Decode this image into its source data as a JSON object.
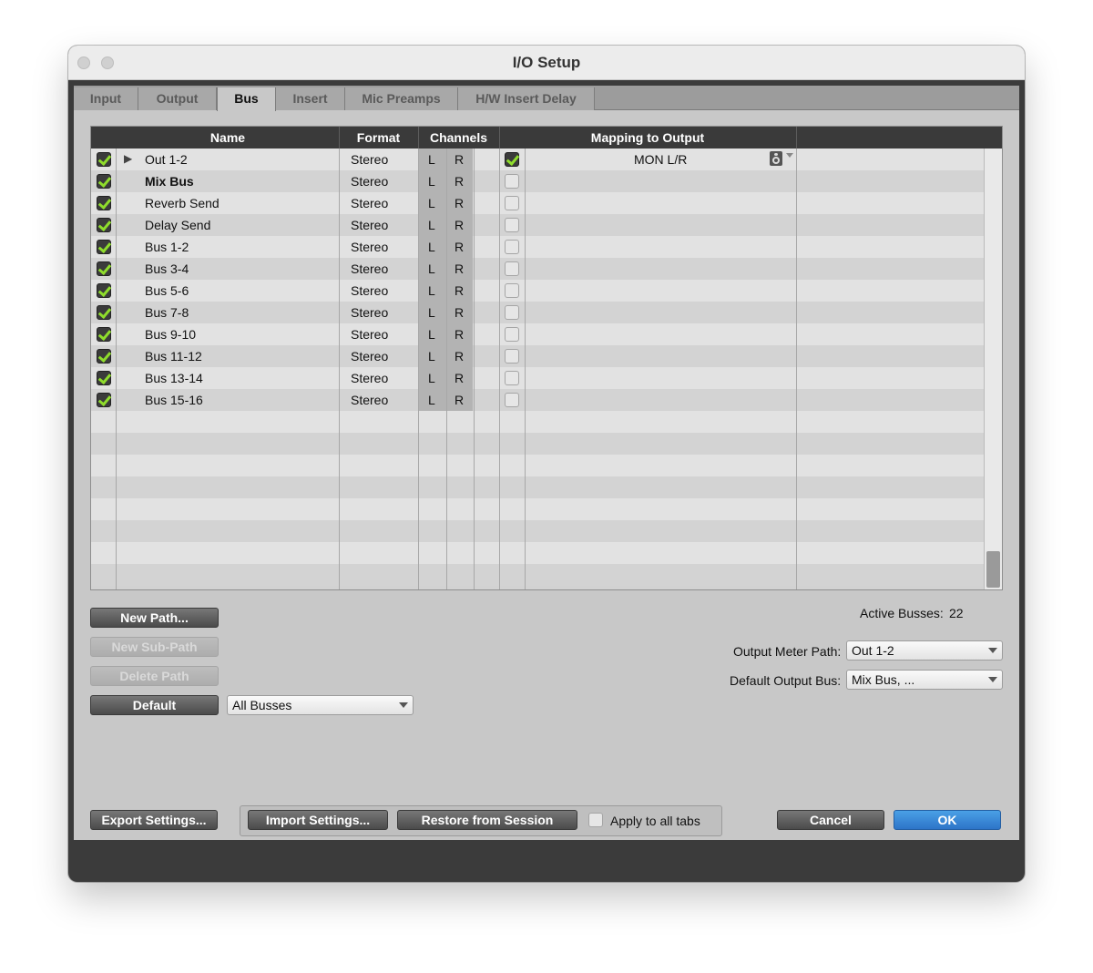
{
  "window": {
    "title": "I/O Setup"
  },
  "tabs": [
    {
      "label": "Input",
      "active": false
    },
    {
      "label": "Output",
      "active": false
    },
    {
      "label": "Bus",
      "active": true
    },
    {
      "label": "Insert",
      "active": false
    },
    {
      "label": "Mic Preamps",
      "active": false
    },
    {
      "label": "H/W Insert Delay",
      "active": false
    }
  ],
  "table": {
    "headers": {
      "name": "Name",
      "format": "Format",
      "channels": "Channels",
      "mapping": "Mapping to Output"
    },
    "rows": [
      {
        "active": true,
        "expander": "▶",
        "name": "Out 1-2",
        "bold": false,
        "format": "Stereo",
        "left": "L",
        "right": "R",
        "mapped": true,
        "mapping": "MON L/R"
      },
      {
        "active": true,
        "expander": "",
        "name": "Mix Bus",
        "bold": true,
        "format": "Stereo",
        "left": "L",
        "right": "R",
        "mapped": false,
        "mapping": ""
      },
      {
        "active": true,
        "expander": "",
        "name": "Reverb Send",
        "bold": false,
        "format": "Stereo",
        "left": "L",
        "right": "R",
        "mapped": false,
        "mapping": ""
      },
      {
        "active": true,
        "expander": "",
        "name": "Delay Send",
        "bold": false,
        "format": "Stereo",
        "left": "L",
        "right": "R",
        "mapped": false,
        "mapping": ""
      },
      {
        "active": true,
        "expander": "",
        "name": "Bus 1-2",
        "bold": false,
        "format": "Stereo",
        "left": "L",
        "right": "R",
        "mapped": false,
        "mapping": ""
      },
      {
        "active": true,
        "expander": "",
        "name": "Bus 3-4",
        "bold": false,
        "format": "Stereo",
        "left": "L",
        "right": "R",
        "mapped": false,
        "mapping": ""
      },
      {
        "active": true,
        "expander": "",
        "name": "Bus 5-6",
        "bold": false,
        "format": "Stereo",
        "left": "L",
        "right": "R",
        "mapped": false,
        "mapping": ""
      },
      {
        "active": true,
        "expander": "",
        "name": "Bus 7-8",
        "bold": false,
        "format": "Stereo",
        "left": "L",
        "right": "R",
        "mapped": false,
        "mapping": ""
      },
      {
        "active": true,
        "expander": "",
        "name": "Bus 9-10",
        "bold": false,
        "format": "Stereo",
        "left": "L",
        "right": "R",
        "mapped": false,
        "mapping": ""
      },
      {
        "active": true,
        "expander": "",
        "name": "Bus 11-12",
        "bold": false,
        "format": "Stereo",
        "left": "L",
        "right": "R",
        "mapped": false,
        "mapping": ""
      },
      {
        "active": true,
        "expander": "",
        "name": "Bus 13-14",
        "bold": false,
        "format": "Stereo",
        "left": "L",
        "right": "R",
        "mapped": false,
        "mapping": ""
      },
      {
        "active": true,
        "expander": "",
        "name": "Bus 15-16",
        "bold": false,
        "format": "Stereo",
        "left": "L",
        "right": "R",
        "mapped": false,
        "mapping": ""
      }
    ],
    "empty_rows": 8
  },
  "controls": {
    "new_path": "New Path...",
    "new_sub_path": "New Sub-Path",
    "delete_path": "Delete Path",
    "default": "Default",
    "filter_value": "All Busses",
    "active_busses_label": "Active Busses:",
    "active_busses_count": "22",
    "output_meter_label": "Output Meter Path:",
    "output_meter_value": "Out 1-2",
    "default_output_label": "Default Output Bus:",
    "default_output_value": "Mix Bus, ..."
  },
  "footer": {
    "export": "Export Settings...",
    "import": "Import Settings...",
    "restore": "Restore from Session",
    "apply_all": "Apply to all tabs",
    "cancel": "Cancel",
    "ok": "OK"
  },
  "colors": {
    "checkmark": "#8fdd2c",
    "header_bg": "#3a3a3a",
    "ok_button": "#2d74c8"
  }
}
